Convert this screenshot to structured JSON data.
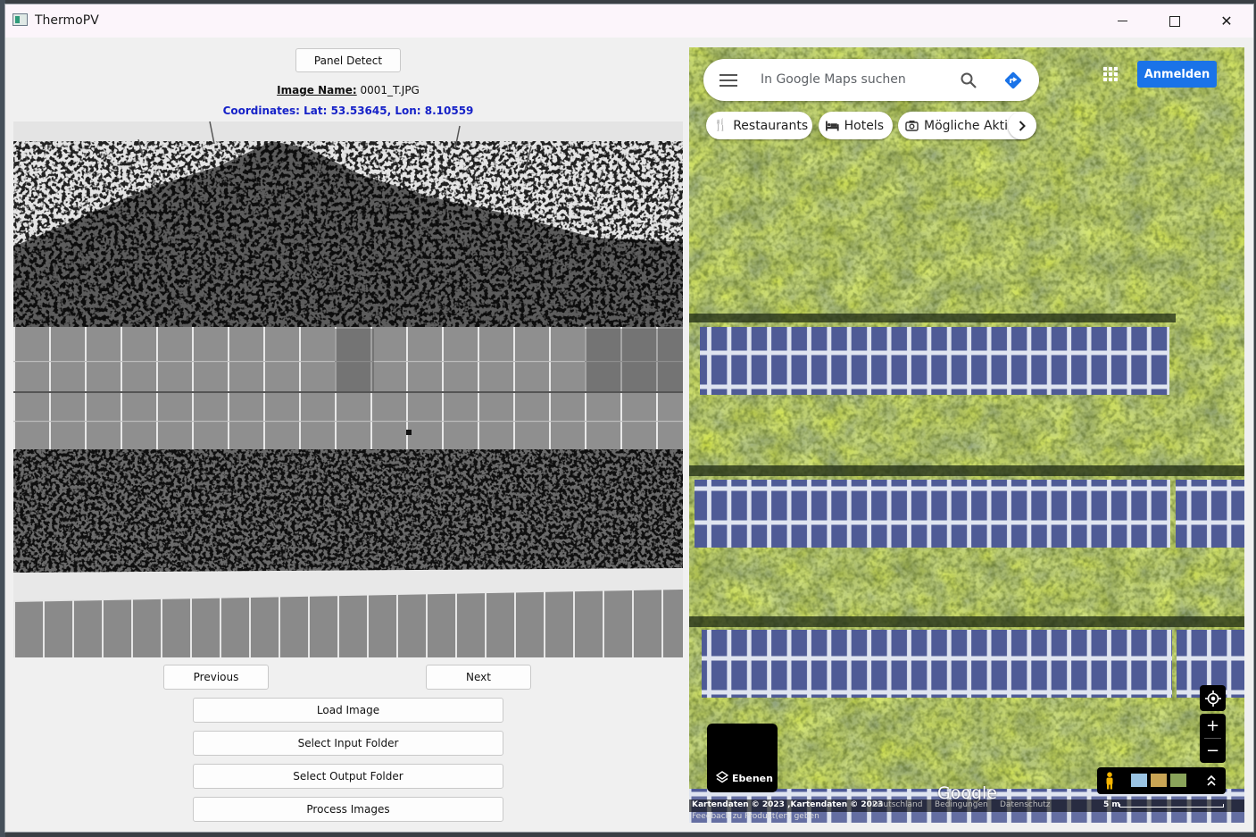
{
  "window": {
    "title": "ThermoPV"
  },
  "toolbar": {
    "panel_detect": "Panel Detect"
  },
  "image_info": {
    "name_label": "Image Name:",
    "name_value": "0001_T.JPG",
    "coordinates": "Coordinates: Lat: 53.53645, Lon: 8.10559"
  },
  "nav": {
    "previous": "Previous",
    "next": "Next"
  },
  "actions": {
    "load_image": "Load Image",
    "select_input": "Select Input Folder",
    "select_output": "Select Output Folder",
    "process": "Process Images"
  },
  "map": {
    "search_placeholder": "In Google Maps suchen",
    "sign_in": "Anmelden",
    "chips": [
      "Restaurants",
      "Hotels",
      "Mögliche Aktiv"
    ],
    "layers_label": "Ebenen",
    "logo": "Google",
    "footer": {
      "attribution": "Kartendaten © 2023 ,Kartendaten © 2023",
      "country": "Deutschland",
      "terms": "Bedingungen",
      "privacy": "Datenschutz",
      "scale": "5 m",
      "feedback": "Feedback zu Produkt(en) geben"
    },
    "icons": [
      "menu-icon",
      "search-icon",
      "directions-icon",
      "apps-grid-icon",
      "restaurant-icon",
      "hotel-icon",
      "camera-icon",
      "chevron-right-icon",
      "my-location-icon",
      "zoom-in-icon",
      "zoom-out-icon",
      "pegman-icon",
      "layers-icon",
      "expand-icon"
    ],
    "colors": {
      "accent": "#1a73e8",
      "coordinates_text": "#1622c8"
    }
  }
}
